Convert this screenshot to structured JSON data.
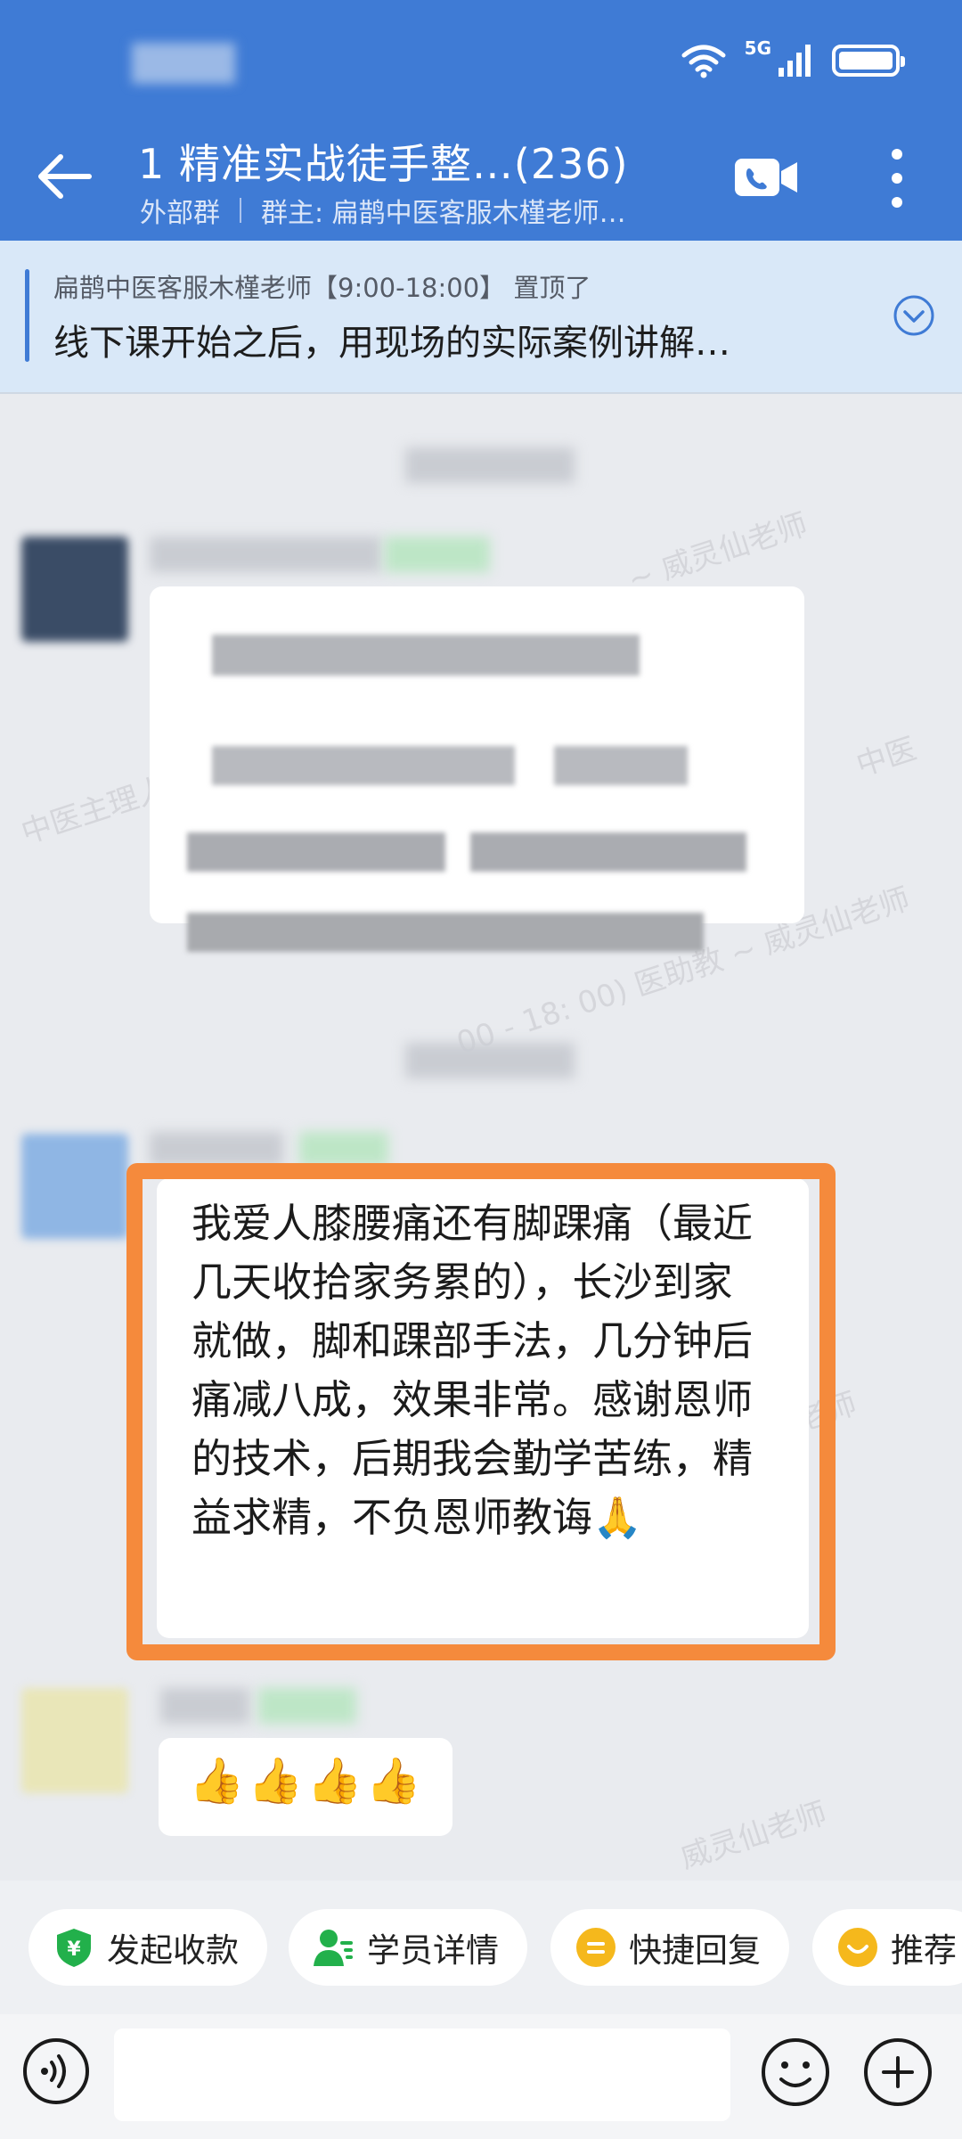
{
  "status_bar": {
    "network": "5G"
  },
  "header": {
    "title": "1  精准实战徒手整…(236)",
    "group_type": "外部群",
    "owner": "群主: 扁鹊中医客服木槿老师…"
  },
  "pinned": {
    "meta": "扁鹊中医客服木槿老师【9:00-18:00】 置顶了",
    "text": "线下课开始之后，用现场的实际案例讲解…"
  },
  "messages": {
    "highlighted_text": "我爱人膝腰痛还有脚踝痛（最近几天收拾家务累的），长沙到家就做，脚和踝部手法，几分钟后痛减八成，效果非常。感谢恩师的技术，后期我会勤学苦练，精益求精，不负恩师教诲🙏",
    "thumbs": "👍👍👍👍"
  },
  "quick_actions": [
    {
      "label": "发起收款",
      "icon": "payment-shield-icon",
      "color": "#22b04b"
    },
    {
      "label": "学员详情",
      "icon": "student-profile-icon",
      "color": "#22b04b"
    },
    {
      "label": "快捷回复",
      "icon": "quick-reply-icon",
      "color": "#f5b81c"
    },
    {
      "label": "推荐",
      "icon": "recommend-icon",
      "color": "#f5b81c"
    }
  ],
  "colors": {
    "header": "#3f7bd5",
    "highlight": "#f58a3c"
  }
}
